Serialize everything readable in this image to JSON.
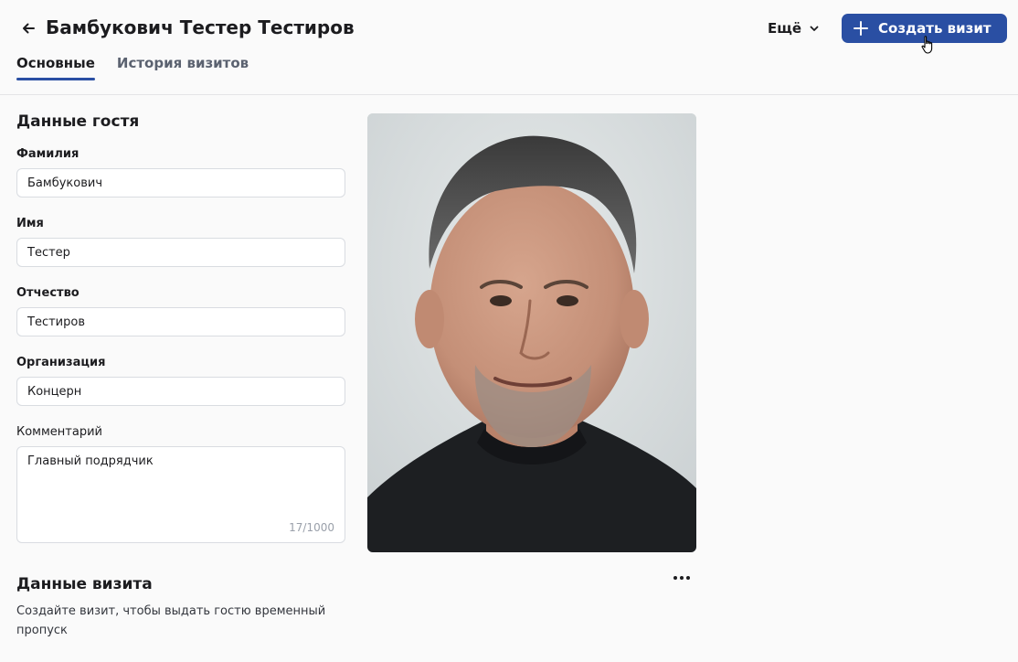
{
  "header": {
    "title": "Бамбукович Тестер Тестиров",
    "more_label": "Ещё",
    "create_label": "Создать визит"
  },
  "tabs": [
    {
      "label": "Основные",
      "active": true
    },
    {
      "label": "История визитов",
      "active": false
    }
  ],
  "guest": {
    "section_title": "Данные гостя",
    "fields": {
      "last_name": {
        "label": "Фамилия",
        "value": "Бамбукович"
      },
      "first_name": {
        "label": "Имя",
        "value": "Тестер"
      },
      "patronymic": {
        "label": "Отчество",
        "value": "Тестиров"
      },
      "organization": {
        "label": "Организация",
        "value": "Концерн"
      },
      "comment": {
        "label": "Комментарий",
        "value": "Главный подрядчик",
        "counter": "17/1000"
      }
    }
  },
  "visit": {
    "section_title": "Данные визита",
    "description": "Создайте визит, чтобы выдать гостю временный пропуск"
  },
  "icons": {
    "back": "arrow-left-icon",
    "more_chevron": "chevron-down-icon",
    "create": "plus-icon",
    "actions": "more-horizontal-icon"
  },
  "colors": {
    "primary": "#2a4fa3",
    "background": "#fafafa",
    "border": "#d9dce1",
    "text": "#1c1c1f"
  }
}
